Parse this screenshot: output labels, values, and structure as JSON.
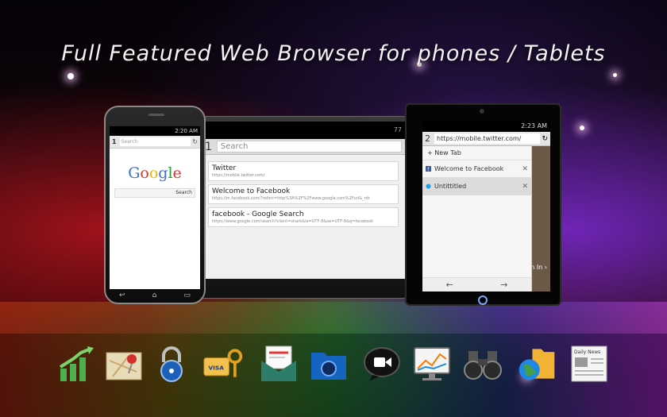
{
  "headline": "Full Featured Web Browser for phones / Tablets",
  "phone": {
    "status_time": "2:20 AM",
    "tab_count": "1",
    "search_placeholder": "Search",
    "reload_glyph": "↻",
    "search_button": "Search"
  },
  "tablet": {
    "status": "77",
    "tab_count": "1",
    "search_placeholder": "Search",
    "items": [
      {
        "title": "Twitter",
        "url": "https://mobile.twitter.com/"
      },
      {
        "title": "Welcome to Facebook",
        "url": "https://m.facebook.com/?refsrc=http%3A%2F%2Fwww.google.com%2Furl&_rdr"
      },
      {
        "title": "facebook - Google Search",
        "url": "https://www.google.com/search?client=shark&ie=UTF-8&oe=UTF-8&q=facebook"
      }
    ]
  },
  "ipad": {
    "status_time": "2:23 AM",
    "tab_count": "2",
    "url": "https://mobile.twitter.com/",
    "reload_glyph": "↻",
    "new_tab": "+ New Tab",
    "tabs": [
      {
        "title": "Welcome to Facebook",
        "active": false
      },
      {
        "title": "Untittitled",
        "active": true
      }
    ],
    "back_glyph": "←",
    "forward_glyph": "→",
    "sign_in": "Sign In ›"
  },
  "dock_icons": [
    "growth-chart-icon",
    "map-pin-icon",
    "padlock-icon",
    "credit-card-key-icon",
    "mail-envelope-icon",
    "music-folder-icon",
    "video-chat-icon",
    "monitor-chart-icon",
    "binoculars-icon",
    "globe-folder-icon",
    "daily-news-icon"
  ],
  "news_label": "Daily News",
  "visa_label": "VISA"
}
